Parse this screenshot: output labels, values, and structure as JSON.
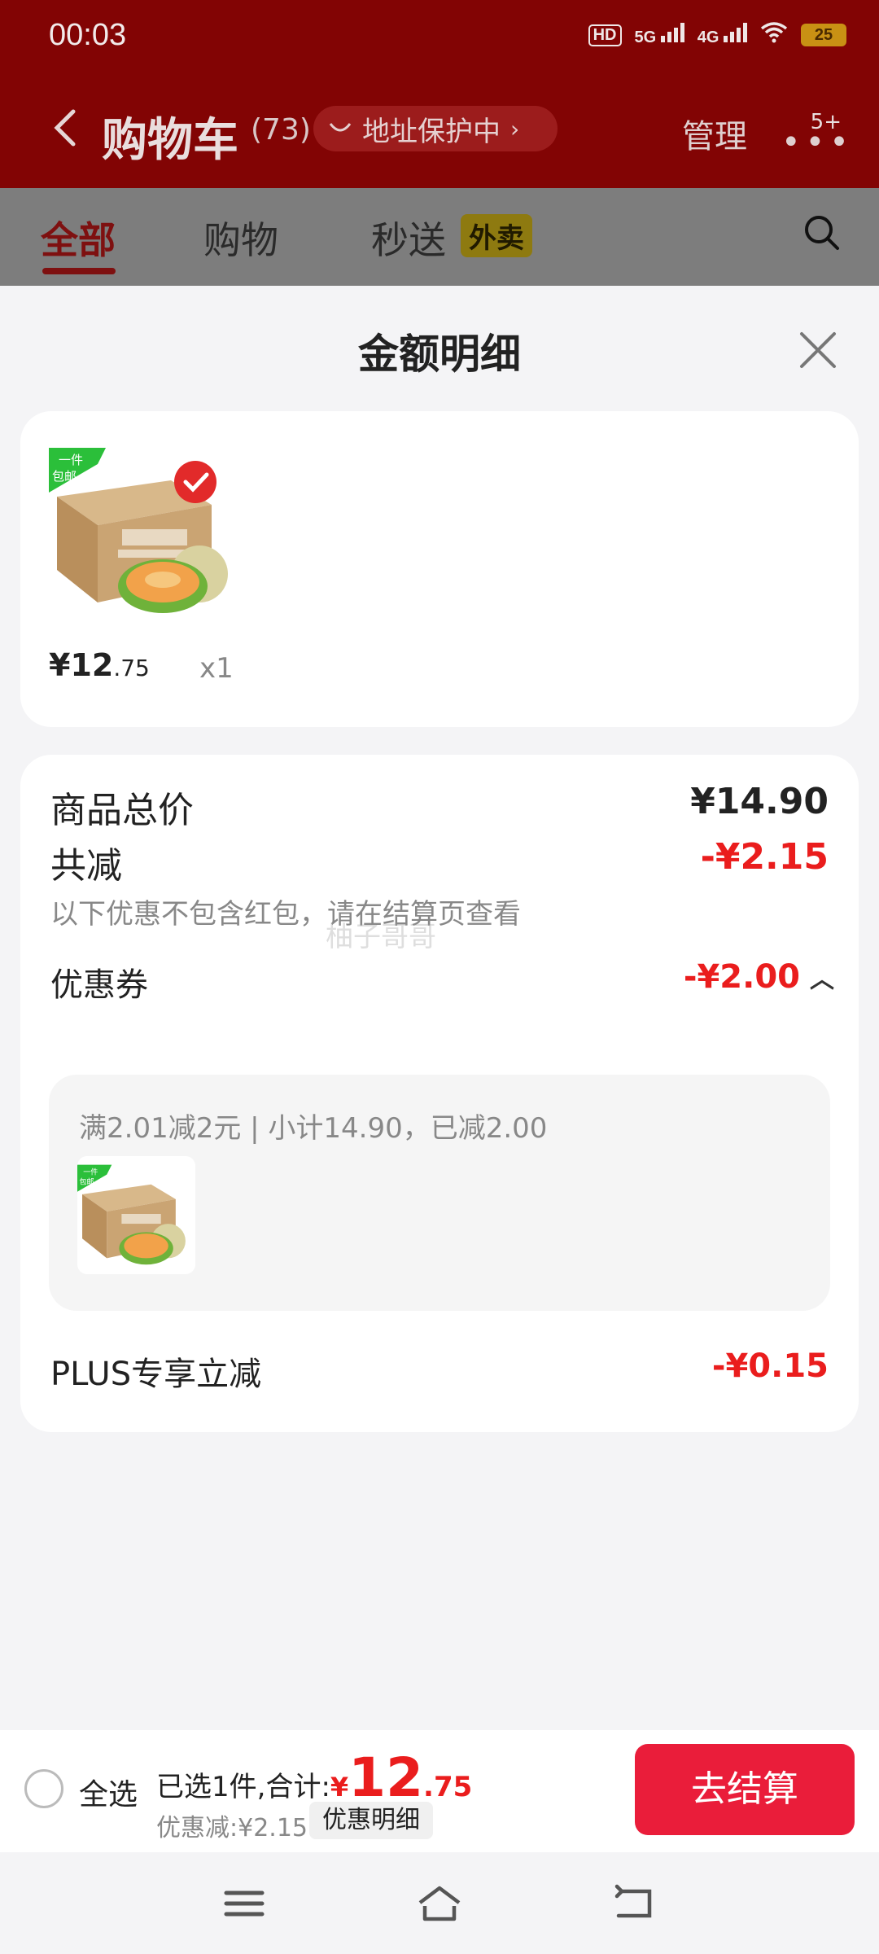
{
  "status_bar": {
    "time": "00:03",
    "hd": "HD",
    "sig1": "5G",
    "sig2": "4G",
    "battery": "25"
  },
  "header": {
    "title": "购物车",
    "count": "(73)",
    "protect_label": "地址保护中",
    "manage": "管理",
    "more_badge": "5+"
  },
  "tabs": [
    {
      "label": "全部"
    },
    {
      "label": "购物"
    },
    {
      "label": "秒送"
    }
  ],
  "tab_badge": "外卖",
  "sheet": {
    "title": "金额明细"
  },
  "product": {
    "price_int": "¥12",
    "price_dec": ".75",
    "qty": "x1",
    "ribbon": "一件包邮"
  },
  "breakdown": {
    "total_label": "商品总价",
    "total_value": "¥14.90",
    "reduce_label": "共减",
    "reduce_value": "-¥2.15",
    "reduce_note": "以下优惠不包含红包，请在结算页查看",
    "coupon_label": "优惠券",
    "coupon_value": "-¥2.00",
    "coupon_detail": "满2.01减2元 | 小计14.90，已减2.00",
    "plus_label": "PLUS专享立减",
    "plus_value": "-¥0.15"
  },
  "watermark": "柚子哥哥",
  "bottom": {
    "select_all": "全选",
    "summary_prefix": "已选1件,合计:",
    "total_sym": "¥",
    "total_int": "12",
    "total_dec": ".75",
    "discount": "优惠减:¥2.15",
    "detail_btn": "优惠明细",
    "checkout": "去结算"
  },
  "colors": {
    "accent": "#ea1d1d",
    "checkout": "#ea1d3a",
    "header": "#820404"
  }
}
